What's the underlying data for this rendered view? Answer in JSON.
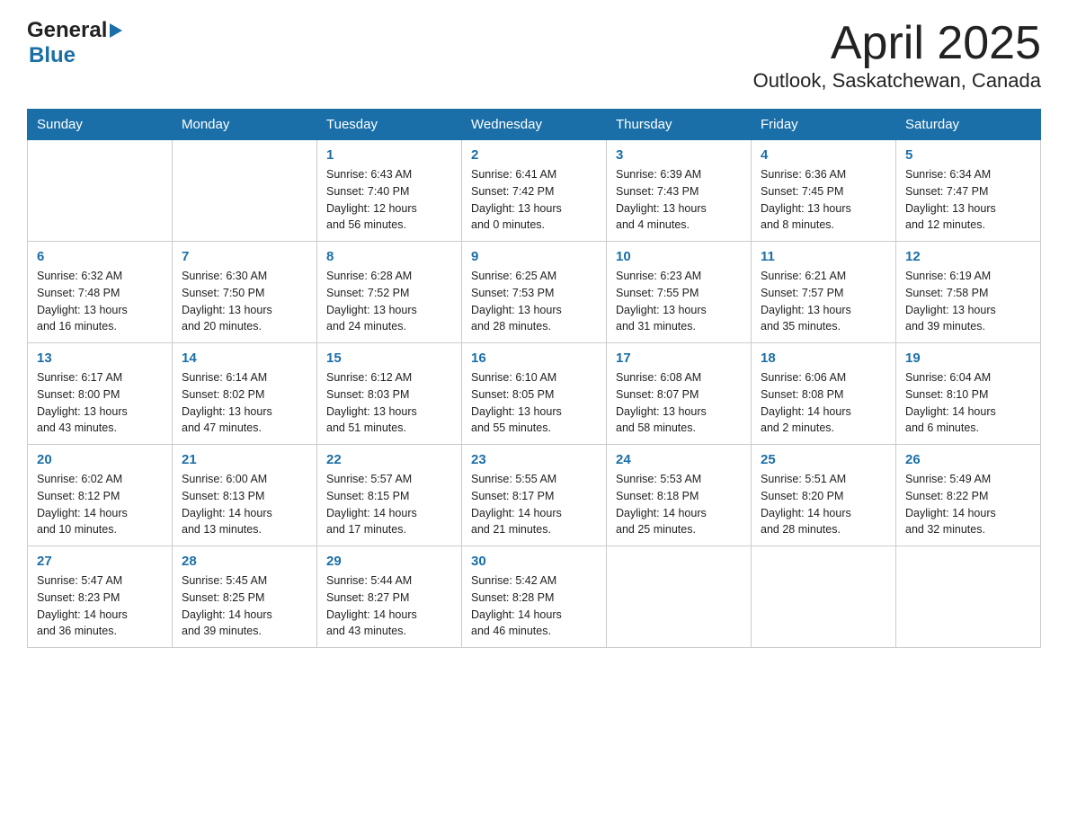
{
  "header": {
    "title": "April 2025",
    "subtitle": "Outlook, Saskatchewan, Canada"
  },
  "logo": {
    "general": "General",
    "blue": "Blue"
  },
  "days_of_week": [
    "Sunday",
    "Monday",
    "Tuesday",
    "Wednesday",
    "Thursday",
    "Friday",
    "Saturday"
  ],
  "weeks": [
    [
      {
        "day": "",
        "info": ""
      },
      {
        "day": "",
        "info": ""
      },
      {
        "day": "1",
        "info": "Sunrise: 6:43 AM\nSunset: 7:40 PM\nDaylight: 12 hours\nand 56 minutes."
      },
      {
        "day": "2",
        "info": "Sunrise: 6:41 AM\nSunset: 7:42 PM\nDaylight: 13 hours\nand 0 minutes."
      },
      {
        "day": "3",
        "info": "Sunrise: 6:39 AM\nSunset: 7:43 PM\nDaylight: 13 hours\nand 4 minutes."
      },
      {
        "day": "4",
        "info": "Sunrise: 6:36 AM\nSunset: 7:45 PM\nDaylight: 13 hours\nand 8 minutes."
      },
      {
        "day": "5",
        "info": "Sunrise: 6:34 AM\nSunset: 7:47 PM\nDaylight: 13 hours\nand 12 minutes."
      }
    ],
    [
      {
        "day": "6",
        "info": "Sunrise: 6:32 AM\nSunset: 7:48 PM\nDaylight: 13 hours\nand 16 minutes."
      },
      {
        "day": "7",
        "info": "Sunrise: 6:30 AM\nSunset: 7:50 PM\nDaylight: 13 hours\nand 20 minutes."
      },
      {
        "day": "8",
        "info": "Sunrise: 6:28 AM\nSunset: 7:52 PM\nDaylight: 13 hours\nand 24 minutes."
      },
      {
        "day": "9",
        "info": "Sunrise: 6:25 AM\nSunset: 7:53 PM\nDaylight: 13 hours\nand 28 minutes."
      },
      {
        "day": "10",
        "info": "Sunrise: 6:23 AM\nSunset: 7:55 PM\nDaylight: 13 hours\nand 31 minutes."
      },
      {
        "day": "11",
        "info": "Sunrise: 6:21 AM\nSunset: 7:57 PM\nDaylight: 13 hours\nand 35 minutes."
      },
      {
        "day": "12",
        "info": "Sunrise: 6:19 AM\nSunset: 7:58 PM\nDaylight: 13 hours\nand 39 minutes."
      }
    ],
    [
      {
        "day": "13",
        "info": "Sunrise: 6:17 AM\nSunset: 8:00 PM\nDaylight: 13 hours\nand 43 minutes."
      },
      {
        "day": "14",
        "info": "Sunrise: 6:14 AM\nSunset: 8:02 PM\nDaylight: 13 hours\nand 47 minutes."
      },
      {
        "day": "15",
        "info": "Sunrise: 6:12 AM\nSunset: 8:03 PM\nDaylight: 13 hours\nand 51 minutes."
      },
      {
        "day": "16",
        "info": "Sunrise: 6:10 AM\nSunset: 8:05 PM\nDaylight: 13 hours\nand 55 minutes."
      },
      {
        "day": "17",
        "info": "Sunrise: 6:08 AM\nSunset: 8:07 PM\nDaylight: 13 hours\nand 58 minutes."
      },
      {
        "day": "18",
        "info": "Sunrise: 6:06 AM\nSunset: 8:08 PM\nDaylight: 14 hours\nand 2 minutes."
      },
      {
        "day": "19",
        "info": "Sunrise: 6:04 AM\nSunset: 8:10 PM\nDaylight: 14 hours\nand 6 minutes."
      }
    ],
    [
      {
        "day": "20",
        "info": "Sunrise: 6:02 AM\nSunset: 8:12 PM\nDaylight: 14 hours\nand 10 minutes."
      },
      {
        "day": "21",
        "info": "Sunrise: 6:00 AM\nSunset: 8:13 PM\nDaylight: 14 hours\nand 13 minutes."
      },
      {
        "day": "22",
        "info": "Sunrise: 5:57 AM\nSunset: 8:15 PM\nDaylight: 14 hours\nand 17 minutes."
      },
      {
        "day": "23",
        "info": "Sunrise: 5:55 AM\nSunset: 8:17 PM\nDaylight: 14 hours\nand 21 minutes."
      },
      {
        "day": "24",
        "info": "Sunrise: 5:53 AM\nSunset: 8:18 PM\nDaylight: 14 hours\nand 25 minutes."
      },
      {
        "day": "25",
        "info": "Sunrise: 5:51 AM\nSunset: 8:20 PM\nDaylight: 14 hours\nand 28 minutes."
      },
      {
        "day": "26",
        "info": "Sunrise: 5:49 AM\nSunset: 8:22 PM\nDaylight: 14 hours\nand 32 minutes."
      }
    ],
    [
      {
        "day": "27",
        "info": "Sunrise: 5:47 AM\nSunset: 8:23 PM\nDaylight: 14 hours\nand 36 minutes."
      },
      {
        "day": "28",
        "info": "Sunrise: 5:45 AM\nSunset: 8:25 PM\nDaylight: 14 hours\nand 39 minutes."
      },
      {
        "day": "29",
        "info": "Sunrise: 5:44 AM\nSunset: 8:27 PM\nDaylight: 14 hours\nand 43 minutes."
      },
      {
        "day": "30",
        "info": "Sunrise: 5:42 AM\nSunset: 8:28 PM\nDaylight: 14 hours\nand 46 minutes."
      },
      {
        "day": "",
        "info": ""
      },
      {
        "day": "",
        "info": ""
      },
      {
        "day": "",
        "info": ""
      }
    ]
  ]
}
